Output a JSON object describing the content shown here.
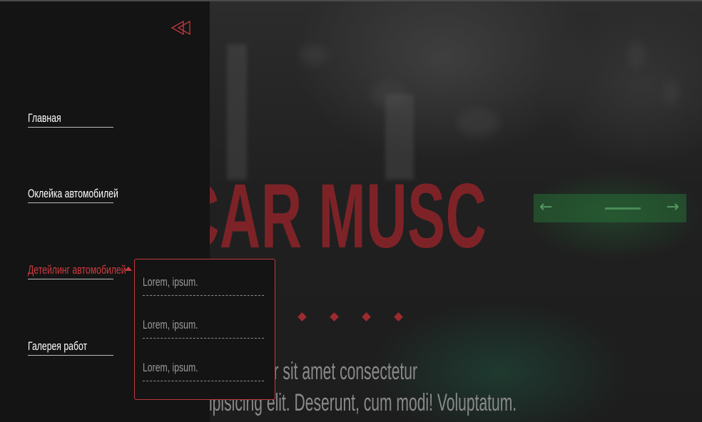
{
  "hero": {
    "title": "CAR MUSC",
    "text_line1": "sum dolor sit amet consectetur",
    "text_line2": "ipisicing elit. Deserunt, cum modi! Voluptatum.",
    "slider_dots": 4
  },
  "sidebar": {
    "collapse_icon": "double-chevron-left-icon",
    "items": [
      {
        "label": "Главная",
        "active": false
      },
      {
        "label": "Оклейка автомобилей",
        "active": false
      },
      {
        "label": "Детейлинг автомобилей",
        "active": true
      },
      {
        "label": "Галерея работ",
        "active": false
      }
    ],
    "dropdown": {
      "items": [
        {
          "label": "Lorem, ipsum."
        },
        {
          "label": "Lorem, ipsum."
        },
        {
          "label": "Lorem, ipsum."
        }
      ]
    }
  },
  "colors": {
    "accent": "#d23a3f",
    "title_red": "#7d2328",
    "sidebar_bg": "#141414",
    "text_white": "#ffffff",
    "muted_text": "#9a9a9a"
  }
}
